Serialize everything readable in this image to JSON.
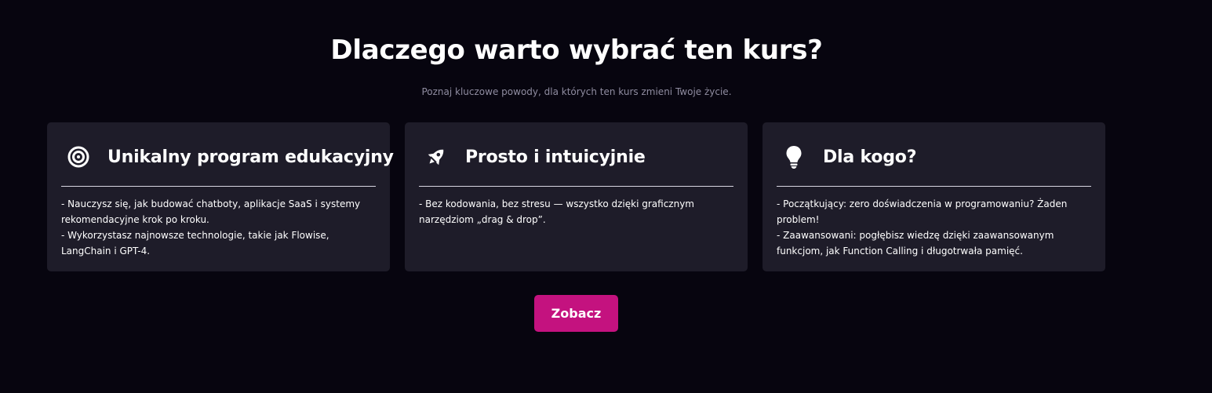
{
  "header": {
    "title": "Dlaczego warto wybrać ten kurs?",
    "subtitle": "Poznaj kluczowe powody, dla których ten kurs zmieni Twoje życie."
  },
  "cards": [
    {
      "icon": "target-icon",
      "title": "Unikalny program edukacyjny",
      "lines": [
        "- Nauczysz się, jak budować chatboty, aplikacje SaaS i systemy rekomendacyjne krok po kroku.",
        "- Wykorzystasz najnowsze technologie, takie jak Flowise, LangChain i GPT-4."
      ]
    },
    {
      "icon": "rocket-icon",
      "title": "Prosto i intuicyjnie",
      "lines": [
        "- Bez kodowania, bez stresu — wszystko dzięki graficznym narzędziom „drag & drop”."
      ]
    },
    {
      "icon": "lightbulb-icon",
      "title": "Dla kogo?",
      "lines": [
        "- Początkujący: zero doświadczenia w programowaniu? Żaden problem!",
        "- Zaawansowani: pogłębisz wiedzę dzięki zaawansowanym funkcjom, jak Function Calling i długotrwała pamięć."
      ]
    }
  ],
  "cta": {
    "label": "Zobacz"
  },
  "colors": {
    "background": "#07050f",
    "card": "#1e1c29",
    "accent": "#c4127f",
    "subtitle": "#8f8ca0"
  }
}
